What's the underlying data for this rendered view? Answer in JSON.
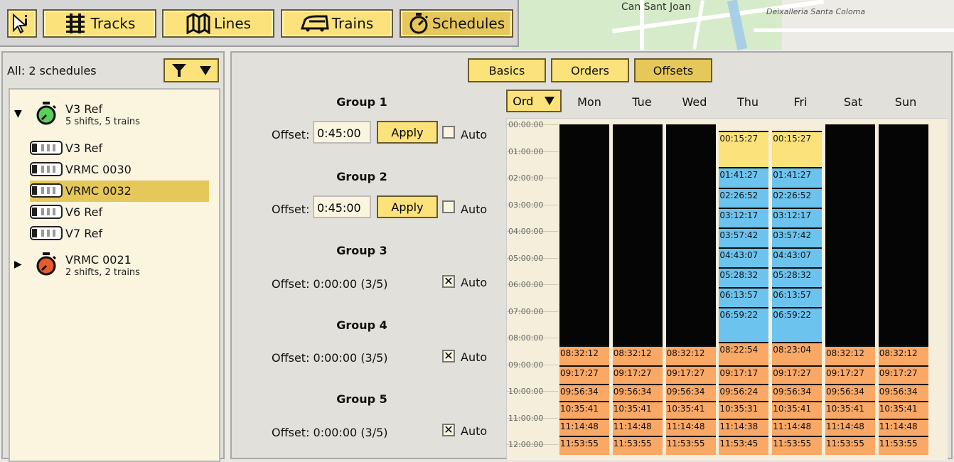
{
  "map": {
    "label_main": "Can Sant Joan",
    "label_small": "Deixalleria Santa Coloma"
  },
  "toolbar": {
    "info_icon": "info-cursor-icon",
    "buttons": [
      {
        "label": "Tracks",
        "icon": "tracks-icon"
      },
      {
        "label": "Lines",
        "icon": "lines-icon"
      },
      {
        "label": "Trains",
        "icon": "train-icon"
      },
      {
        "label": "Schedules",
        "icon": "stopwatch-icon",
        "active": true
      }
    ]
  },
  "left": {
    "summary": "All: 2 schedules",
    "schedules": [
      {
        "name": "V3 Ref",
        "sub": "5 shifts, 5 trains",
        "expanded": true,
        "color": "#5ad05a",
        "trains": [
          {
            "name": "V3 Ref",
            "selected": false
          },
          {
            "name": "VRMC 0030",
            "selected": false
          },
          {
            "name": "VRMC 0032",
            "selected": true
          },
          {
            "name": "V6 Ref",
            "selected": false
          },
          {
            "name": "V7 Ref",
            "selected": false
          }
        ]
      },
      {
        "name": "VRMC 0021",
        "sub": "2 shifts, 2 trains",
        "expanded": false,
        "color": "#e85a2a",
        "trains": []
      }
    ]
  },
  "right": {
    "tabs": [
      {
        "label": "Basics"
      },
      {
        "label": "Orders"
      },
      {
        "label": "Offsets",
        "active": true
      }
    ],
    "groups": [
      {
        "title": "Group 1",
        "offset_label": "Offset:",
        "offset_value": "0:45:00",
        "editable": true,
        "apply": "Apply",
        "auto": false,
        "auto_label": "Auto"
      },
      {
        "title": "Group 2",
        "offset_label": "Offset:",
        "offset_value": "0:45:00",
        "editable": true,
        "apply": "Apply",
        "auto": false,
        "auto_label": "Auto"
      },
      {
        "title": "Group 3",
        "offset_label": "Offset: 0:00:00 (3/5)",
        "editable": false,
        "auto": true,
        "auto_label": "Auto"
      },
      {
        "title": "Group 4",
        "offset_label": "Offset: 0:00:00 (3/5)",
        "editable": false,
        "auto": true,
        "auto_label": "Auto"
      },
      {
        "title": "Group 5",
        "offset_label": "Offset: 0:00:00 (3/5)",
        "editable": false,
        "auto": true,
        "auto_label": "Auto"
      }
    ],
    "ord_label": "Ord",
    "days": [
      "Mon",
      "Tue",
      "Wed",
      "Thu",
      "Fri",
      "Sat",
      "Sun"
    ],
    "hours": [
      "00:00:00",
      "01:00:00",
      "02:00:00",
      "03:00:00",
      "04:00:00",
      "05:00:00",
      "06:00:00",
      "07:00:00",
      "08:00:00",
      "09:00:00",
      "10:00:00",
      "11:00:00",
      "12:00:00"
    ],
    "colors": {
      "black": "#050505",
      "yellow": "#fbe27a",
      "blue": "#6cc4ee",
      "orange": "#f9a866"
    },
    "columns": [
      {
        "blocks": [
          {
            "t": "",
            "c": "black",
            "s": 0,
            "e": 8.3
          },
          {
            "t": "08:32:12",
            "c": "orange",
            "s": 8.3,
            "e": 9.05
          },
          {
            "t": "09:17:27",
            "c": "orange",
            "s": 9.05,
            "e": 9.72
          },
          {
            "t": "09:56:34",
            "c": "orange",
            "s": 9.72,
            "e": 10.38
          },
          {
            "t": "10:35:41",
            "c": "orange",
            "s": 10.38,
            "e": 11.03
          },
          {
            "t": "11:14:48",
            "c": "orange",
            "s": 11.03,
            "e": 11.68
          },
          {
            "t": "11:53:55",
            "c": "orange",
            "s": 11.68,
            "e": 12.4
          }
        ]
      },
      {
        "blocks": [
          {
            "t": "",
            "c": "black",
            "s": 0,
            "e": 8.3
          },
          {
            "t": "08:32:12",
            "c": "orange",
            "s": 8.3,
            "e": 9.05
          },
          {
            "t": "09:17:27",
            "c": "orange",
            "s": 9.05,
            "e": 9.72
          },
          {
            "t": "09:56:34",
            "c": "orange",
            "s": 9.72,
            "e": 10.38
          },
          {
            "t": "10:35:41",
            "c": "orange",
            "s": 10.38,
            "e": 11.03
          },
          {
            "t": "11:14:48",
            "c": "orange",
            "s": 11.03,
            "e": 11.68
          },
          {
            "t": "11:53:55",
            "c": "orange",
            "s": 11.68,
            "e": 12.4
          }
        ]
      },
      {
        "blocks": [
          {
            "t": "",
            "c": "black",
            "s": 0,
            "e": 8.3
          },
          {
            "t": "08:32:12",
            "c": "orange",
            "s": 8.3,
            "e": 9.05
          },
          {
            "t": "09:17:27",
            "c": "orange",
            "s": 9.05,
            "e": 9.72
          },
          {
            "t": "09:56:34",
            "c": "orange",
            "s": 9.72,
            "e": 10.38
          },
          {
            "t": "10:35:41",
            "c": "orange",
            "s": 10.38,
            "e": 11.03
          },
          {
            "t": "11:14:48",
            "c": "orange",
            "s": 11.03,
            "e": 11.68
          },
          {
            "t": "11:53:55",
            "c": "orange",
            "s": 11.68,
            "e": 12.4
          }
        ]
      },
      {
        "blocks": [
          {
            "t": "00:15:27",
            "c": "yellow",
            "s": 0.25,
            "e": 1.6
          },
          {
            "t": "01:41:27",
            "c": "blue",
            "s": 1.6,
            "e": 2.36
          },
          {
            "t": "02:26:52",
            "c": "blue",
            "s": 2.36,
            "e": 3.11
          },
          {
            "t": "03:12:17",
            "c": "blue",
            "s": 3.11,
            "e": 3.86
          },
          {
            "t": "03:57:42",
            "c": "blue",
            "s": 3.86,
            "e": 4.61
          },
          {
            "t": "04:43:07",
            "c": "blue",
            "s": 4.61,
            "e": 5.36
          },
          {
            "t": "05:28:32",
            "c": "blue",
            "s": 5.36,
            "e": 6.11
          },
          {
            "t": "06:13:57",
            "c": "blue",
            "s": 6.11,
            "e": 6.86
          },
          {
            "t": "06:59:22",
            "c": "blue",
            "s": 6.86,
            "e": 8.16
          },
          {
            "t": "08:22:54",
            "c": "orange",
            "s": 8.16,
            "e": 9.05
          },
          {
            "t": "09:17:17",
            "c": "orange",
            "s": 9.05,
            "e": 9.72
          },
          {
            "t": "09:56:24",
            "c": "orange",
            "s": 9.72,
            "e": 10.38
          },
          {
            "t": "10:35:31",
            "c": "orange",
            "s": 10.38,
            "e": 11.03
          },
          {
            "t": "11:14:38",
            "c": "orange",
            "s": 11.03,
            "e": 11.68
          },
          {
            "t": "11:53:45",
            "c": "orange",
            "s": 11.68,
            "e": 12.4
          }
        ]
      },
      {
        "blocks": [
          {
            "t": "00:15:27",
            "c": "yellow",
            "s": 0.25,
            "e": 1.6
          },
          {
            "t": "01:41:27",
            "c": "blue",
            "s": 1.6,
            "e": 2.36
          },
          {
            "t": "02:26:52",
            "c": "blue",
            "s": 2.36,
            "e": 3.11
          },
          {
            "t": "03:12:17",
            "c": "blue",
            "s": 3.11,
            "e": 3.86
          },
          {
            "t": "03:57:42",
            "c": "blue",
            "s": 3.86,
            "e": 4.61
          },
          {
            "t": "04:43:07",
            "c": "blue",
            "s": 4.61,
            "e": 5.36
          },
          {
            "t": "05:28:32",
            "c": "blue",
            "s": 5.36,
            "e": 6.11
          },
          {
            "t": "06:13:57",
            "c": "blue",
            "s": 6.11,
            "e": 6.86
          },
          {
            "t": "06:59:22",
            "c": "blue",
            "s": 6.86,
            "e": 8.16
          },
          {
            "t": "08:23:04",
            "c": "orange",
            "s": 8.16,
            "e": 9.05
          },
          {
            "t": "09:17:27",
            "c": "orange",
            "s": 9.05,
            "e": 9.72
          },
          {
            "t": "09:56:34",
            "c": "orange",
            "s": 9.72,
            "e": 10.38
          },
          {
            "t": "10:35:41",
            "c": "orange",
            "s": 10.38,
            "e": 11.03
          },
          {
            "t": "11:14:48",
            "c": "orange",
            "s": 11.03,
            "e": 11.68
          },
          {
            "t": "11:53:55",
            "c": "orange",
            "s": 11.68,
            "e": 12.4
          }
        ]
      },
      {
        "blocks": [
          {
            "t": "",
            "c": "black",
            "s": 0,
            "e": 8.3
          },
          {
            "t": "08:32:12",
            "c": "orange",
            "s": 8.3,
            "e": 9.05
          },
          {
            "t": "09:17:27",
            "c": "orange",
            "s": 9.05,
            "e": 9.72
          },
          {
            "t": "09:56:34",
            "c": "orange",
            "s": 9.72,
            "e": 10.38
          },
          {
            "t": "10:35:41",
            "c": "orange",
            "s": 10.38,
            "e": 11.03
          },
          {
            "t": "11:14:48",
            "c": "orange",
            "s": 11.03,
            "e": 11.68
          },
          {
            "t": "11:53:55",
            "c": "orange",
            "s": 11.68,
            "e": 12.4
          }
        ]
      },
      {
        "blocks": [
          {
            "t": "",
            "c": "black",
            "s": 0,
            "e": 8.3
          },
          {
            "t": "08:32:12",
            "c": "orange",
            "s": 8.3,
            "e": 9.05
          },
          {
            "t": "09:17:27",
            "c": "orange",
            "s": 9.05,
            "e": 9.72
          },
          {
            "t": "09:56:34",
            "c": "orange",
            "s": 9.72,
            "e": 10.38
          },
          {
            "t": "10:35:41",
            "c": "orange",
            "s": 10.38,
            "e": 11.03
          },
          {
            "t": "11:14:48",
            "c": "orange",
            "s": 11.03,
            "e": 11.68
          },
          {
            "t": "11:53:55",
            "c": "orange",
            "s": 11.68,
            "e": 12.4
          }
        ]
      }
    ]
  }
}
